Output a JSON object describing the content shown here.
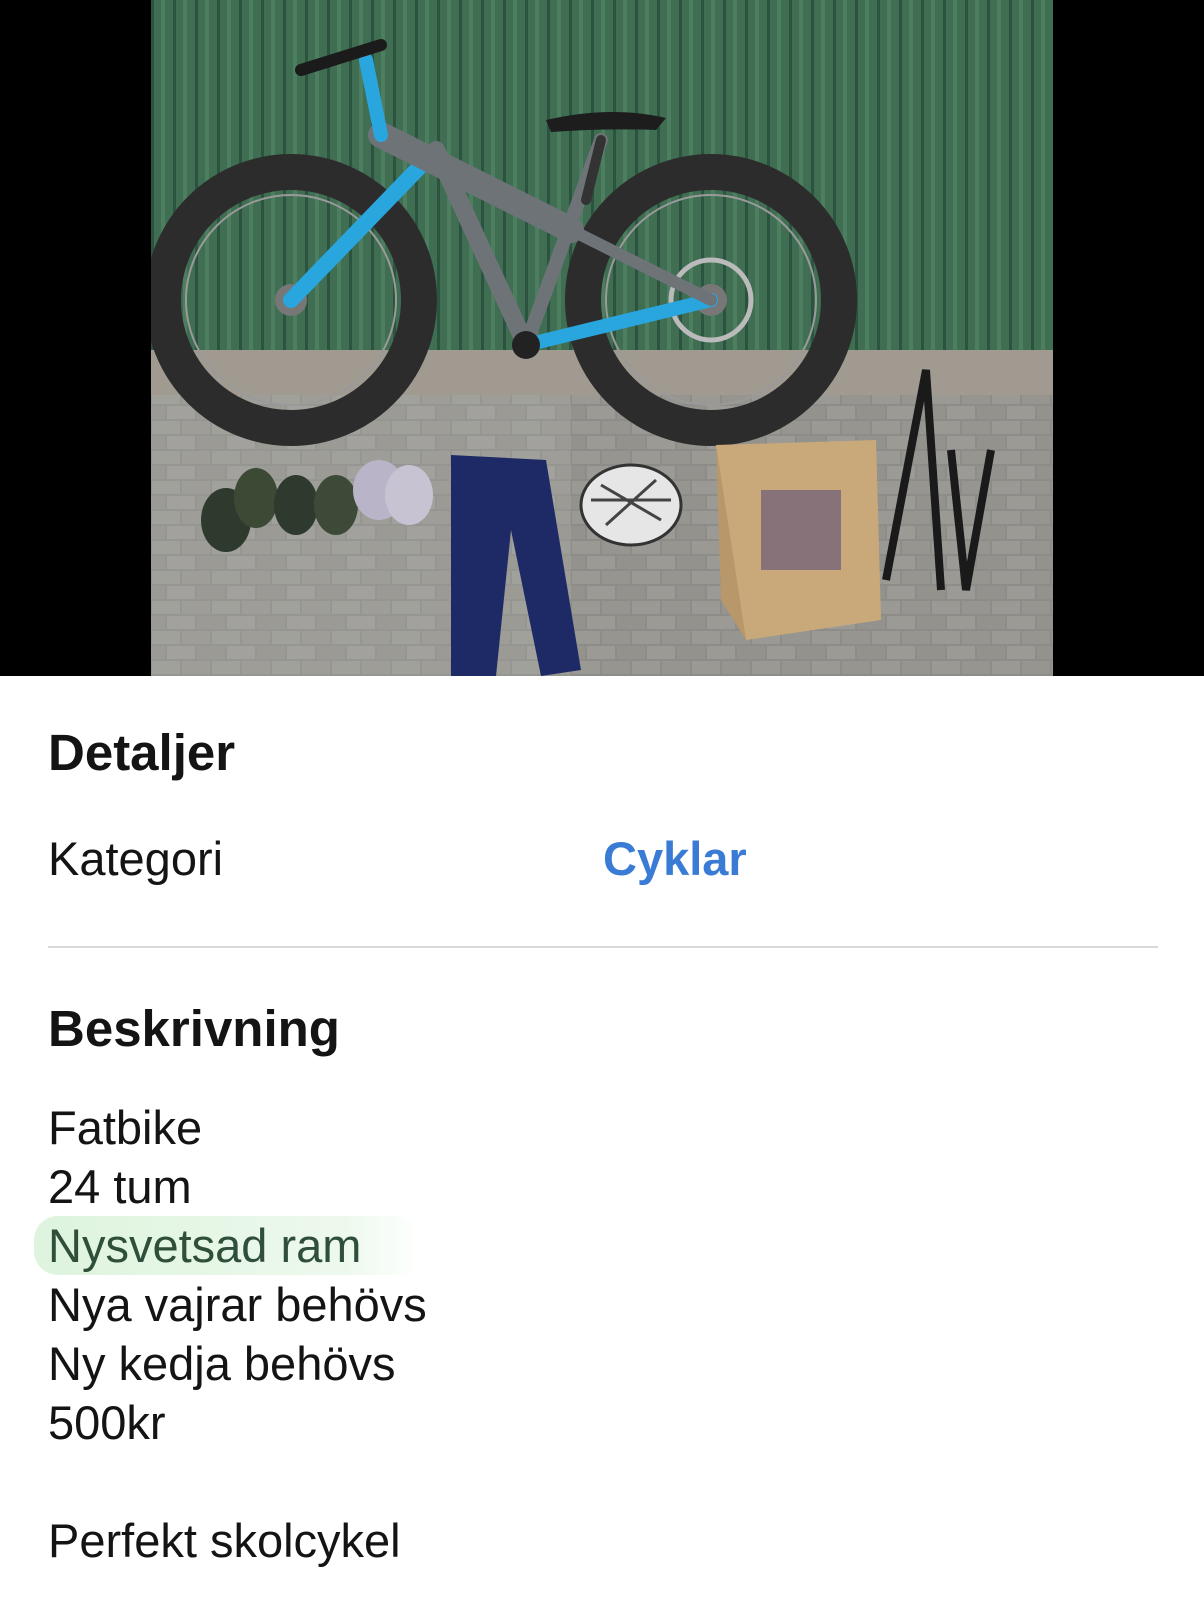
{
  "photo": {
    "alt_icon": "listing-photo-icon",
    "colors": {
      "fence": "#3d6b4f",
      "pavement": "#8a8a86",
      "frame": "#2aa6df",
      "frame_gray": "#6e7378"
    }
  },
  "details": {
    "title": "Detaljer",
    "category_label": "Kategori",
    "category_value": "Cyklar"
  },
  "description": {
    "title": "Beskrivning",
    "lines": [
      "Fatbike",
      "24 tum",
      "Nysvetsad ram",
      "Nya vajrar behövs",
      "Ny kedja behövs",
      "500kr",
      "",
      "Perfekt skolcykel"
    ]
  },
  "colors": {
    "link": "#3a7bd5",
    "text": "#141414",
    "divider": "#d9d9d9",
    "highlight": "#d2f0d2"
  }
}
